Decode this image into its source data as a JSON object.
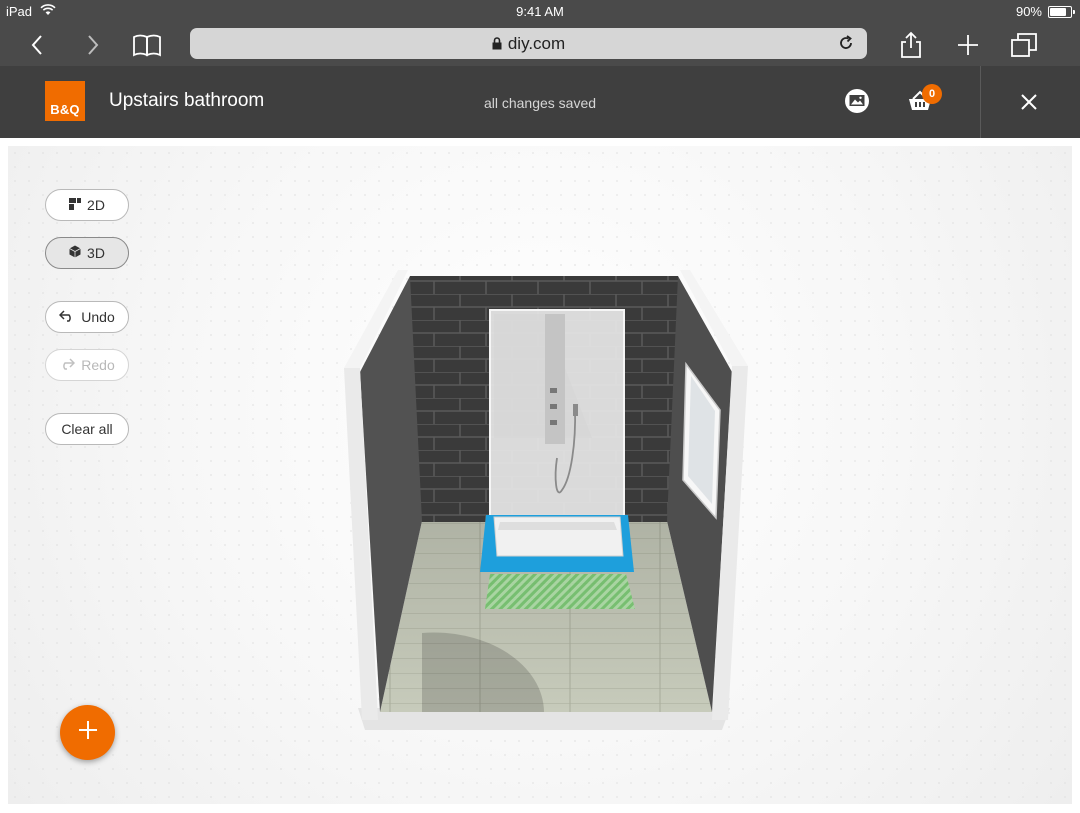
{
  "status_bar": {
    "device": "iPad",
    "time": "9:41 AM",
    "battery_text": "90%",
    "battery_level": 0.9,
    "icons": [
      "wifi-icon",
      "battery-icon"
    ]
  },
  "browser": {
    "url": "diy.com",
    "icons": [
      "back-icon",
      "forward-icon",
      "bookmarks-icon",
      "lock-icon",
      "reload-icon",
      "share-icon",
      "new-tab-icon",
      "tabs-icon"
    ]
  },
  "header": {
    "logo_text": "B&Q",
    "project_title": "Upstairs bathroom",
    "save_status": "all changes saved",
    "cart_count": "0",
    "icons": [
      "gallery-icon",
      "basket-icon",
      "close-icon"
    ]
  },
  "controls": {
    "view_2d": "2D",
    "view_3d": "3D",
    "undo": "Undo",
    "redo": "Redo",
    "clear_all": "Clear all",
    "active_view": "3D"
  },
  "colors": {
    "brand_orange": "#f06c00",
    "header_bg": "#3f3f3f",
    "browser_bg": "#4a4a4a",
    "selection_blue": "#1e9fdc",
    "floor_marker_green": "#7bc67b"
  }
}
